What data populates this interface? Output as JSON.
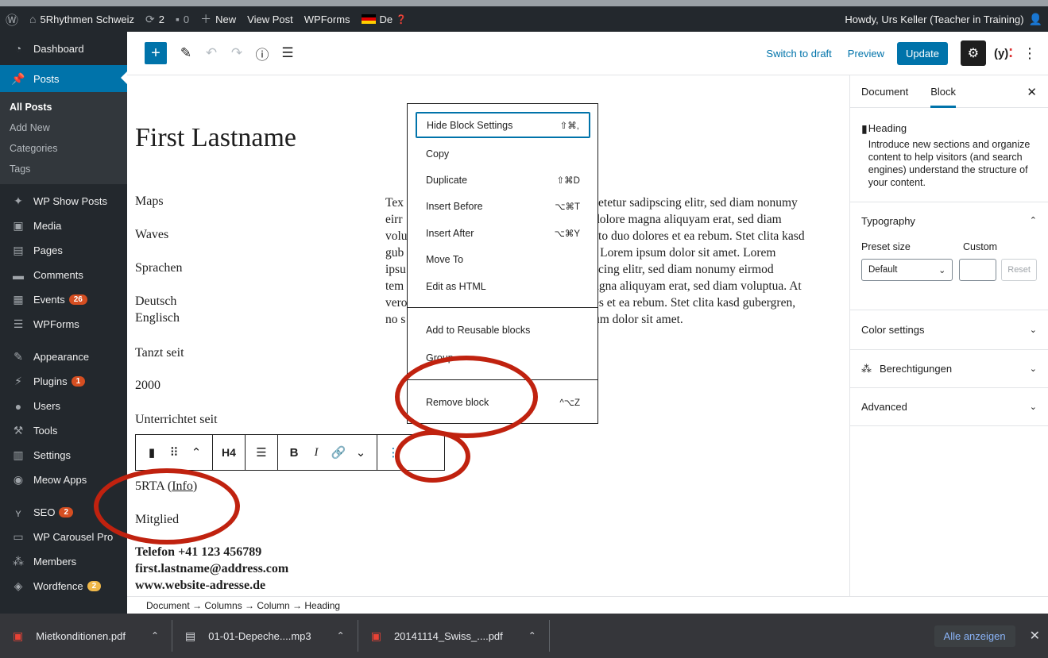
{
  "adminbar": {
    "site": "5Rhythmen Schweiz",
    "updates": "2",
    "comments": "0",
    "new": "New",
    "view_post": "View Post",
    "wpforms": "WPForms",
    "lang": "De",
    "howdy": "Howdy, Urs Keller (Teacher in Training)"
  },
  "sidebar": {
    "dashboard": "Dashboard",
    "posts": "Posts",
    "sub": [
      "All Posts",
      "Add New",
      "Categories",
      "Tags"
    ],
    "items": [
      {
        "label": "WP Show Posts",
        "icon": "pin-icon"
      },
      {
        "label": "Media",
        "icon": "media-icon"
      },
      {
        "label": "Pages",
        "icon": "pages-icon"
      },
      {
        "label": "Comments",
        "icon": "comments-icon"
      },
      {
        "label": "Events",
        "badge": "26",
        "icon": "calendar-icon"
      },
      {
        "label": "WPForms",
        "icon": "forms-icon"
      },
      {
        "label": "Appearance",
        "icon": "brush-icon"
      },
      {
        "label": "Plugins",
        "badge": "1",
        "icon": "plugin-icon"
      },
      {
        "label": "Users",
        "icon": "users-icon"
      },
      {
        "label": "Tools",
        "icon": "wrench-icon"
      },
      {
        "label": "Settings",
        "icon": "settings-icon"
      },
      {
        "label": "Meow Apps",
        "icon": "meow-icon"
      },
      {
        "label": "SEO",
        "badge": "2",
        "icon": "yoast-icon"
      },
      {
        "label": "WP Carousel Pro",
        "icon": "carousel-icon"
      },
      {
        "label": "Members",
        "icon": "members-icon"
      },
      {
        "label": "Wordfence",
        "badge": "2",
        "icon": "wordfence-icon"
      }
    ]
  },
  "toolbar": {
    "switch_to_draft": "Switch to draft",
    "preview": "Preview",
    "update": "Update"
  },
  "content": {
    "title": "First Lastname",
    "left": [
      "Maps",
      "Waves",
      "Sprachen",
      "Deutsch",
      "Englisch",
      "Tanzt seit",
      "2000",
      "Unterrichtet seit",
      "5RTA (",
      "Info",
      ")",
      "Mitglied"
    ],
    "right_lines": [
      "Tex",
      "setetur sadipscing elitr, sed diam nonumy",
      "eirr",
      "dolore magna aliquyam erat, sed diam",
      "volu",
      "sto duo dolores et ea rebum. Stet clita kasd",
      "gub",
      "t Lorem ipsum dolor sit amet. Lorem",
      "ipsu",
      "scing elitr, sed diam nonumy eirmod",
      "tem",
      "agna aliquyam erat, sed diam voluptua. At",
      "vero",
      "es et ea rebum. Stet clita kasd gubergren,",
      "no s",
      "um dolor sit amet."
    ],
    "contact": [
      "Telefon +41 123 456789",
      "first.lastname@address.com",
      "www.website-adresse.de"
    ]
  },
  "block_toolbar": {
    "heading_level": "H4",
    "bold": "B",
    "italic": "I"
  },
  "dropdown": {
    "items": [
      {
        "label": "Hide Block Settings",
        "shortcut": "⇧⌘,"
      },
      {
        "label": "Copy",
        "shortcut": ""
      },
      {
        "label": "Duplicate",
        "shortcut": "⇧⌘D"
      },
      {
        "label": "Insert Before",
        "shortcut": "⌥⌘T"
      },
      {
        "label": "Insert After",
        "shortcut": "⌥⌘Y"
      },
      {
        "label": "Move To",
        "shortcut": ""
      },
      {
        "label": "Edit as HTML",
        "shortcut": ""
      },
      {
        "label": "Add to Reusable blocks",
        "shortcut": ""
      },
      {
        "label": "Group",
        "shortcut": ""
      },
      {
        "label": "Remove block",
        "shortcut": "^⌥Z"
      }
    ]
  },
  "sidepanel": {
    "tab_document": "Document",
    "tab_block": "Block",
    "block_name": "Heading",
    "block_desc": "Introduce new sections and organize content to help visitors (and search engines) understand the structure of your content.",
    "typography": "Typography",
    "preset_size": "Preset size",
    "custom": "Custom",
    "select_value": "Default",
    "reset": "Reset",
    "color_settings": "Color settings",
    "berechtigungen": "Berechtigungen",
    "advanced": "Advanced"
  },
  "breadcrumb": "Document → Columns → Column → Heading",
  "downloads": {
    "files": [
      "Mietkonditionen.pdf",
      "01-01-Depeche....mp3",
      "20141114_Swiss_....pdf"
    ],
    "show_all": "Alle anzeigen"
  },
  "colors": {
    "admin_dark": "#23282d",
    "wp_blue": "#0073aa",
    "annotation_red": "#c0220f"
  }
}
